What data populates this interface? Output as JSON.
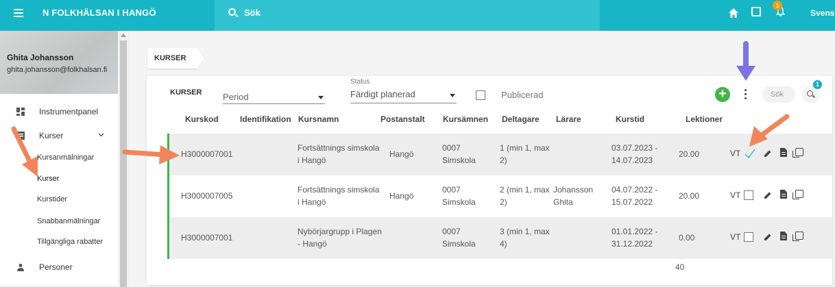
{
  "app": {
    "title": "N FOLKHÄLSAN I HANGÖ",
    "search_placeholder": "Sök",
    "notification_count": "1",
    "language": "Svensk",
    "accent_color": "#16b6c6"
  },
  "user": {
    "name": "Ghita Johansson",
    "email": "ghita.johansson@folkhalsan.fi"
  },
  "sidebar": {
    "items": [
      {
        "label": "Instrumentpanel",
        "icon": "dashboard-icon"
      },
      {
        "label": "Kurser",
        "icon": "courses-icon"
      },
      {
        "label": "Personer",
        "icon": "person-icon"
      }
    ],
    "subitems": [
      "Kursanmälningar",
      "Kurser",
      "Kurstider",
      "Snabbanmälningar",
      "Tillgängliga rabatter"
    ]
  },
  "breadcrumb": "KURSER",
  "filters": {
    "label": "KURSER",
    "period_placeholder": "Period",
    "status_label": "Status",
    "status_value": "Färdigt planerad",
    "published_label": "Publicerad",
    "search_placeholder": "Sök",
    "search_filter_count": "1"
  },
  "table": {
    "columns": [
      "Kurskod",
      "Identifikation",
      "Kursnamn",
      "Postanstalt",
      "Kursämnen",
      "Deltagare",
      "Lärare",
      "Kurstid",
      "Lektioner"
    ],
    "rows": [
      {
        "kurskod": "H3000007001",
        "identifikation": "",
        "kursnamn_1": "Fortsättnings simskola",
        "kursnamn_2": "i Hangö",
        "postanstalt": "Hangö",
        "kursamnen_1": "0007",
        "kursamnen_2": "Simskola",
        "deltagare_1": "1 (min 1, max",
        "deltagare_2": "2)",
        "larare_1": "",
        "larare_2": "",
        "kurstid_1": "03.07.2023 -",
        "kurstid_2": "14.07.2023",
        "lektioner": "20.00",
        "vt": "VT",
        "checked": true
      },
      {
        "kurskod": "H3000007005",
        "identifikation": "",
        "kursnamn_1": "Fortsättnings simskola",
        "kursnamn_2": "i Hangö",
        "postanstalt": "Hangö",
        "kursamnen_1": "0007",
        "kursamnen_2": "Simskola",
        "deltagare_1": "2 (min 1, max",
        "deltagare_2": "2)",
        "larare_1": "Johansson",
        "larare_2": "Ghita",
        "kurstid_1": "04.07.2022 -",
        "kurstid_2": "15.07.2022",
        "lektioner": "20.00",
        "vt": "VT",
        "checked": false
      },
      {
        "kurskod": "H3000007001",
        "identifikation": "",
        "kursnamn_1": "Nybörjargrupp i Plagen",
        "kursnamn_2": "- Hangö",
        "postanstalt": "",
        "kursamnen_1": "0007",
        "kursamnen_2": "Simskola",
        "deltagare_1": "3 (min 1, max",
        "deltagare_2": "4)",
        "larare_1": "",
        "larare_2": "",
        "kurstid_1": "01.01.2022 -",
        "kurstid_2": "31.12.2022",
        "lektioner": "0.00",
        "vt": "VT",
        "checked": false
      }
    ],
    "total_lessons": "40"
  }
}
